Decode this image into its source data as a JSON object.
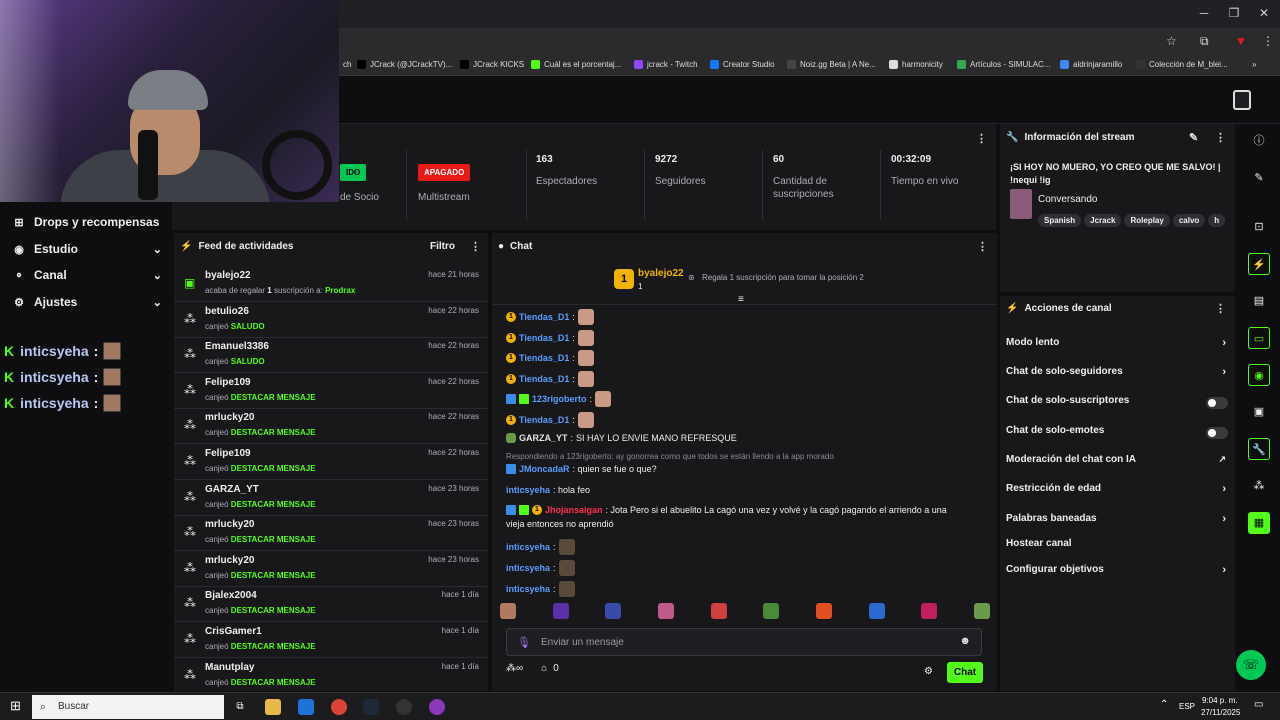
{
  "bookmarks": [
    {
      "label": "ch",
      "color": "#888"
    },
    {
      "label": "JCrack (@JCrackTV)...",
      "color": "#000"
    },
    {
      "label": "JCrack KICKS",
      "color": "#000"
    },
    {
      "label": "Cuál es el porcentaj...",
      "color": "#53fc18"
    },
    {
      "label": "jcrack - Twitch",
      "color": "#9146ff"
    },
    {
      "label": "Creator Studio",
      "color": "#1877f2"
    },
    {
      "label": "Noiz.gg Beta | A Ne...",
      "color": "#444"
    },
    {
      "label": "harmonicity",
      "color": "#ddd"
    },
    {
      "label": "Artículos - SIMULAC...",
      "color": "#34a853"
    },
    {
      "label": "aldrinjaramillo",
      "color": "#4285f4"
    },
    {
      "label": "Colección de M_blei...",
      "color": "#333"
    }
  ],
  "sidebar": {
    "items": [
      {
        "label": "Drops y recompensas",
        "icon": "gift-icon"
      },
      {
        "label": "Estudio",
        "icon": "studio-icon"
      },
      {
        "label": "Canal",
        "icon": "channel-icon"
      },
      {
        "label": "Ajustes",
        "icon": "gear-icon"
      }
    ],
    "kick_rows": [
      {
        "user": "inticsyeha",
        "sep": ":"
      },
      {
        "user": "inticsyeha",
        "sep": ":"
      },
      {
        "user": "inticsyeha",
        "sep": ":"
      }
    ]
  },
  "stats": {
    "partner_badge": "IDO",
    "partner_label": "de Socio",
    "multistream_badge": "APAGADO",
    "multistream_label": "Multistream",
    "viewers": "163",
    "viewers_label": "Espectadores",
    "followers": "9272",
    "followers_label": "Seguidores",
    "subs": "60",
    "subs_label": "Cantidad de suscripciones",
    "uptime": "00:32:09",
    "uptime_label": "Tiempo en vivo"
  },
  "feed": {
    "title": "Feed de actividades",
    "filter": "Filtro",
    "rows": [
      {
        "user": "byalejo22",
        "time": "hace 21 horas",
        "pre": "acaba de regalar ",
        "mid": "1",
        "post": " suscripción a: ",
        "highlight": "Prodrax",
        "icon": "gift-icon"
      },
      {
        "user": "betulio26",
        "time": "hace 22 horas",
        "pre": "canjeó ",
        "highlight": "SALUDO",
        "icon": "points-icon"
      },
      {
        "user": "Emanuel3386",
        "time": "hace 22 horas",
        "pre": "canjeó ",
        "highlight": "SALUDO",
        "icon": "points-icon"
      },
      {
        "user": "Felipe109",
        "time": "hace 22 horas",
        "pre": "canjeó ",
        "highlight": "DESTACAR MENSAJE",
        "icon": "points-icon"
      },
      {
        "user": "mrlucky20",
        "time": "hace 22 horas",
        "pre": "canjeó ",
        "highlight": "DESTACAR MENSAJE",
        "icon": "points-icon"
      },
      {
        "user": "Felipe109",
        "time": "hace 22 horas",
        "pre": "canjeó ",
        "highlight": "DESTACAR MENSAJE",
        "icon": "points-icon"
      },
      {
        "user": "GARZA_YT",
        "time": "hace 23 horas",
        "pre": "canjeó ",
        "highlight": "DESTACAR MENSAJE",
        "icon": "points-icon"
      },
      {
        "user": "mrlucky20",
        "time": "hace 23 horas",
        "pre": "canjeó ",
        "highlight": "DESTACAR MENSAJE",
        "icon": "points-icon"
      },
      {
        "user": "mrlucky20",
        "time": "hace 23 horas",
        "pre": "canjeó ",
        "highlight": "DESTACAR MENSAJE",
        "icon": "points-icon"
      },
      {
        "user": "Bjalex2004",
        "time": "hace 1 día",
        "pre": "canjeó ",
        "highlight": "DESTACAR MENSAJE",
        "icon": "points-icon"
      },
      {
        "user": "CrisGamer1",
        "time": "hace 1 día",
        "pre": "canjeó ",
        "highlight": "DESTACAR MENSAJE",
        "icon": "points-icon"
      },
      {
        "user": "Manutplay",
        "time": "hace 1 día",
        "pre": "canjeó ",
        "highlight": "DESTACAR MENSAJE",
        "icon": "points-icon"
      }
    ]
  },
  "chat": {
    "title": "Chat",
    "pinned_user": "byalejo22",
    "pinned_count": "1",
    "pinned_text": "Regala 1 suscripción para tomar la posición 2",
    "messages": [
      {
        "user": "Tiendas_D1",
        "sep": ":",
        "text": ""
      },
      {
        "user": "Tiendas_D1",
        "sep": ":",
        "text": ""
      },
      {
        "user": "Tiendas_D1",
        "sep": ":",
        "text": ""
      },
      {
        "user": "Tiendas_D1",
        "sep": ":",
        "text": ""
      },
      {
        "user": "123rigoberto",
        "sep": ":",
        "text": ""
      },
      {
        "user": "Tiendas_D1",
        "sep": ":",
        "text": ""
      },
      {
        "user": "GARZA_YT",
        "sep": ":",
        "text": "SI HAY LO ENVIE MANO REFRESQUE"
      }
    ],
    "reply_text": "Respondiendo a 123rigoberto: ay gonorrea como que todos se están llendo a la app morado",
    "reply_user": "JMoncadaR",
    "reply_msg": ": quien se fue o que?",
    "m_hola_user": "inticsyeha",
    "m_hola_text": ": hola feo",
    "long_user": "Jhojansaigan",
    "long_text_1": ": Jota Pero si el abuelito La cagó una vez y volvé y la cagó pagando el arriendo a una",
    "long_text_2": "vieja entonces no aprendió",
    "tail_users": [
      "inticsyeha",
      "inticsyeha",
      "inticsyeha"
    ],
    "input_placeholder": "Enviar un mensaje",
    "footer_count": "0",
    "send_label": "Chat"
  },
  "info": {
    "title": "Información del stream",
    "stream_title": "¡SI HOY NO MUERO, YO CREO QUE ME SALVO! | !nequi !ig",
    "category": "Conversando",
    "tags": [
      "Spanish",
      "Jcrack",
      "Roleplay",
      "calvo",
      "h"
    ]
  },
  "actions": {
    "title": "Acciones de canal",
    "rows": [
      {
        "label": "Modo lento",
        "kind": "chevron"
      },
      {
        "label": "Chat de solo-seguidores",
        "kind": "chevron"
      },
      {
        "label": "Chat de solo-suscriptores",
        "kind": "toggle"
      },
      {
        "label": "Chat de solo-emotes",
        "kind": "toggle"
      },
      {
        "label": "Moderación del chat con IA",
        "kind": "external"
      },
      {
        "label": "Restricción de edad",
        "kind": "chevron"
      },
      {
        "label": "Palabras baneadas",
        "kind": "chevron"
      },
      {
        "label": "Hostear canal",
        "kind": "none"
      },
      {
        "label": "Configurar objetivos",
        "kind": "chevron"
      }
    ]
  },
  "taskbar": {
    "search": "Buscar",
    "lang": "ESP",
    "time": "9:04 p. m.",
    "date": "27/11/2025"
  },
  "colors": {
    "accent": "#53fc18",
    "danger": "#e91916",
    "bg": "#0e0e10",
    "panel": "#18181b"
  }
}
